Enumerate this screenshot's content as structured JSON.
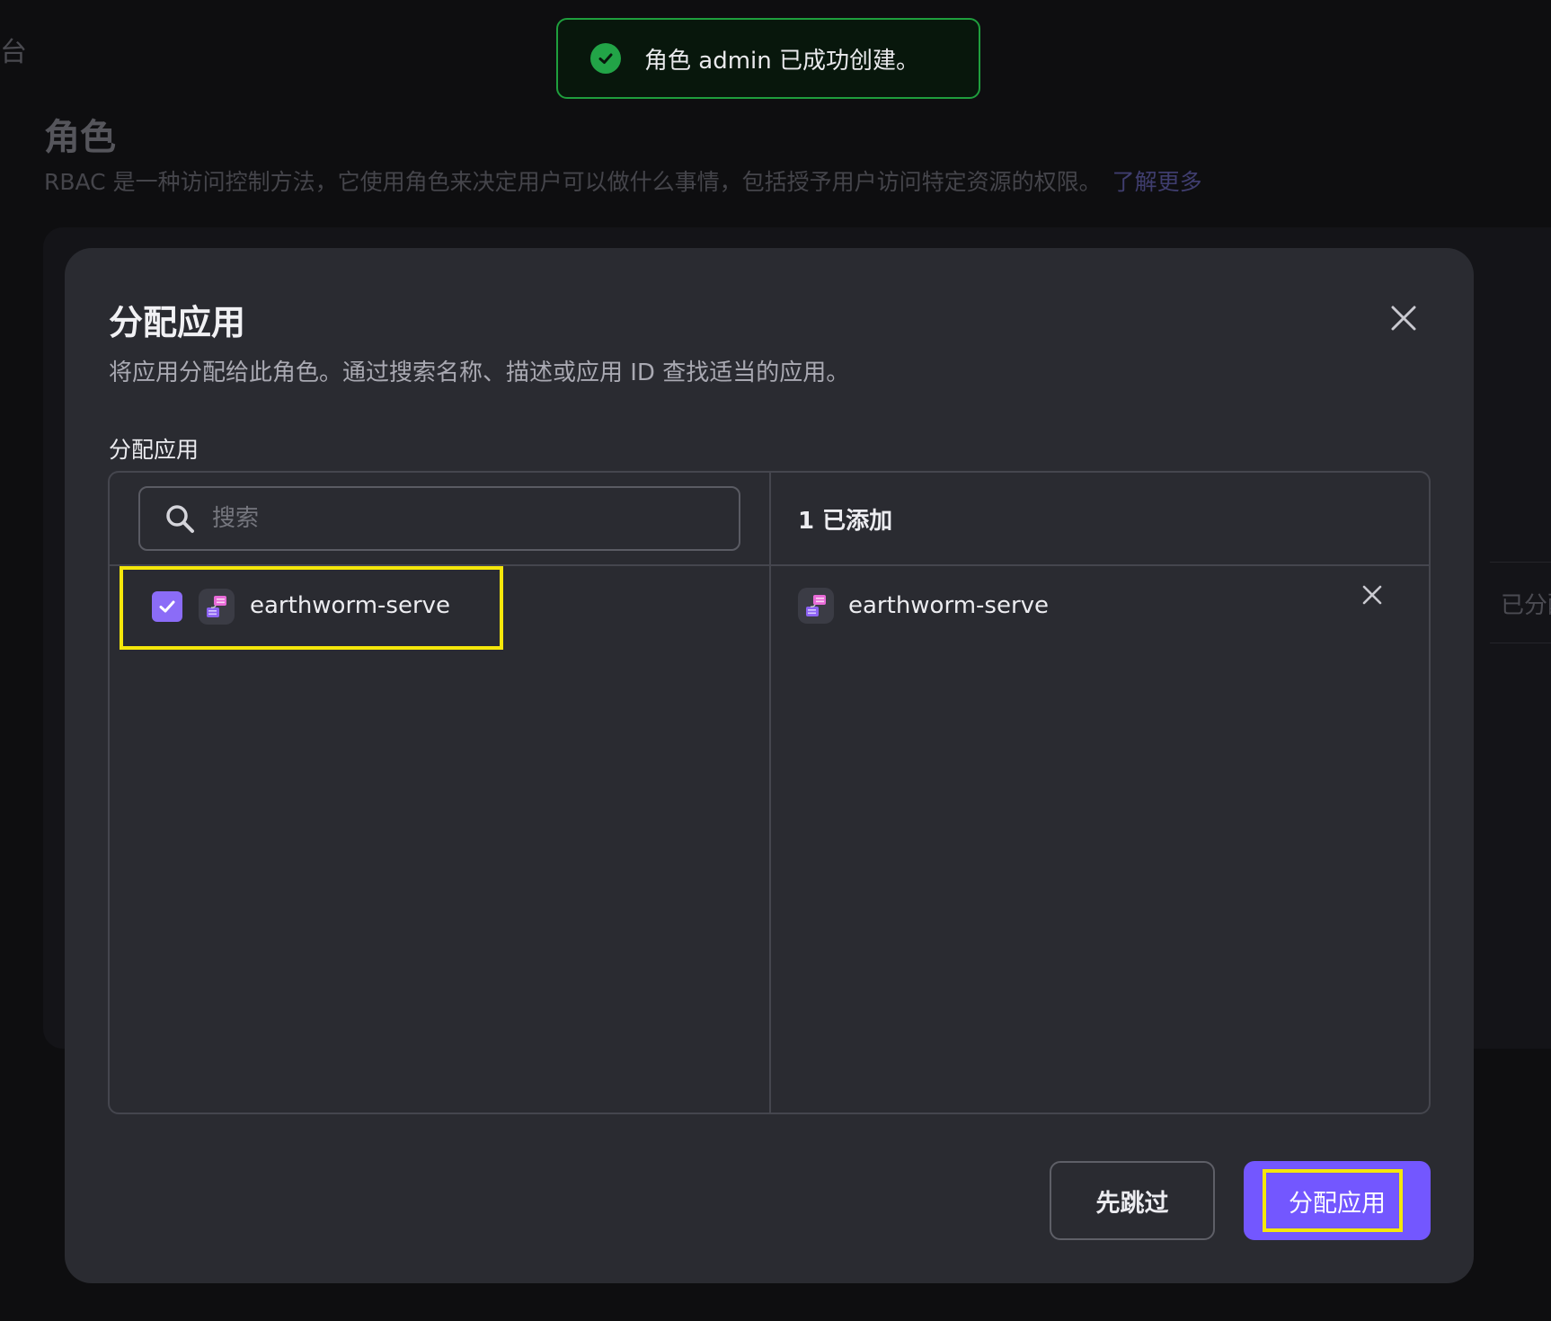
{
  "background": {
    "crumb": "台",
    "title": "角色",
    "description": "RBAC 是一种访问控制方法，它使用角色来决定用户可以做什么事情，包括授予用户访问特定资源的权限。",
    "learn_more": "了解更多",
    "card_tab": "已分配"
  },
  "toast": {
    "message": "角色 admin 已成功创建。",
    "icon": "check-circle-icon",
    "color": "#22a447"
  },
  "modal": {
    "title": "分配应用",
    "subtitle": "将应用分配给此角色。通过搜索名称、描述或应用 ID 查找适当的应用。",
    "field_label": "分配应用",
    "search": {
      "placeholder": "搜索",
      "value": ""
    },
    "available_apps": [
      {
        "name": "earthworm-serve",
        "checked": true
      }
    ],
    "selected": {
      "count_label": "1 已添加",
      "apps": [
        {
          "name": "earthworm-serve"
        }
      ]
    },
    "buttons": {
      "skip": "先跳过",
      "assign": "分配应用"
    },
    "accent_color": "#7357ff"
  }
}
